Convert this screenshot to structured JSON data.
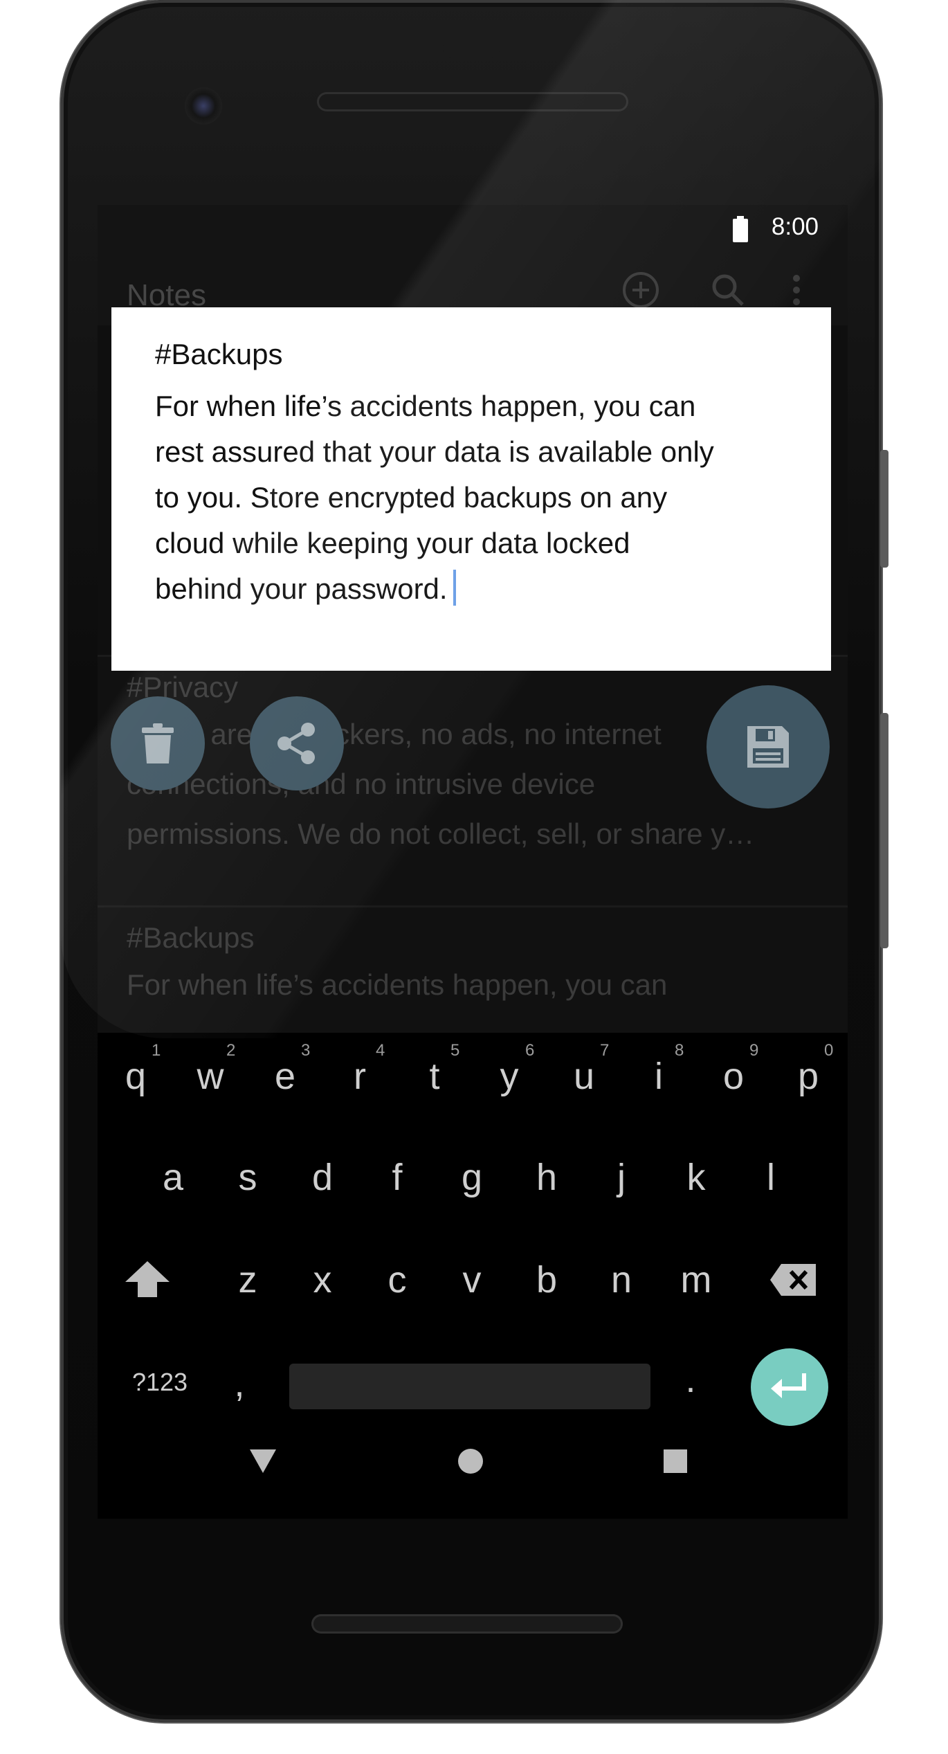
{
  "status_bar": {
    "time": "8:00",
    "battery_icon": "battery-full-icon"
  },
  "app_bar": {
    "title": "Notes",
    "icons": [
      "add-circle-icon",
      "search-icon",
      "more-vert-icon"
    ]
  },
  "notes_list": [
    {
      "title": "#Privacy",
      "lines": [
        "There are no trackers, no ads, no internet",
        "connections, and no intrusive device",
        "permissions. We do not collect, sell, or share y…"
      ]
    },
    {
      "title": "#Backups",
      "lines": [
        "For when life’s accidents happen, you can"
      ]
    }
  ],
  "editor": {
    "title": "#Backups",
    "lines": [
      "For when life’s accidents happen, you can",
      "rest assured that your data is available only",
      "to you. Store encrypted backups on any",
      "cloud while keeping your data locked",
      "behind your password."
    ]
  },
  "actions": {
    "delete_icon": "trash-icon",
    "share_icon": "share-icon",
    "save_icon": "save-icon"
  },
  "keyboard": {
    "row1": [
      "q",
      "w",
      "e",
      "r",
      "t",
      "y",
      "u",
      "i",
      "o",
      "p"
    ],
    "row1_hints": [
      "1",
      "2",
      "3",
      "4",
      "5",
      "6",
      "7",
      "8",
      "9",
      "0"
    ],
    "row2": [
      "a",
      "s",
      "d",
      "f",
      "g",
      "h",
      "j",
      "k",
      "l"
    ],
    "row3": [
      "z",
      "x",
      "c",
      "v",
      "b",
      "n",
      "m"
    ],
    "symbols_key": "?123",
    "comma_key": ",",
    "period_key": ".",
    "shift_icon": "shift-icon",
    "backspace_icon": "backspace-icon",
    "enter_icon": "enter-icon"
  },
  "nav_bar": {
    "icons": [
      "back-triangle-icon",
      "home-circle-icon",
      "recents-square-icon"
    ]
  },
  "colors": {
    "fab": "#3f5663",
    "enter_key": "#79cdc1",
    "cursor": "#6a9ee6"
  }
}
